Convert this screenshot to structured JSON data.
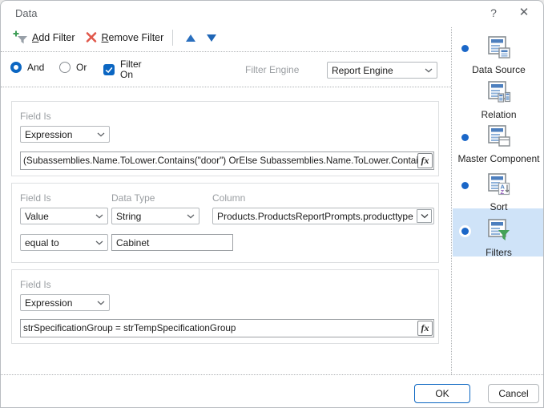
{
  "window": {
    "title": "Data",
    "help": "?",
    "close": "✕"
  },
  "toolbar": {
    "add_filter": {
      "accesskey": "A",
      "rest": "dd Filter"
    },
    "remove_filter": {
      "accesskey": "R",
      "rest": "emove Filter"
    }
  },
  "options": {
    "and_label": "And",
    "or_label": "Or",
    "filter_on_label": "Filter On",
    "filter_engine_label": "Filter Engine",
    "filter_engine_value": "Report Engine"
  },
  "filters": [
    {
      "field_is_label": "Field Is",
      "field_is_value": "Expression",
      "expression": "(Subassemblies.Name.ToLower.Contains(\"door\") OrElse Subassemblies.Name.ToLower.Contains(\"front",
      "fx_label": "fx"
    },
    {
      "field_is_label": "Field Is",
      "data_type_label": "Data Type",
      "column_label": "Column",
      "field_is_value": "Value",
      "data_type_value": "String",
      "column_value": "Products.ProductsReportPrompts.producttype",
      "operator_value": "equal to",
      "value_text": "Cabinet"
    },
    {
      "field_is_label": "Field Is",
      "field_is_value": "Expression",
      "expression": "strSpecificationGroup = strTempSpecificationGroup",
      "fx_label": "fx"
    }
  ],
  "sidebar": {
    "items": [
      {
        "label": "Data Source",
        "dot": true,
        "selected": false
      },
      {
        "label": "Relation",
        "dot": false,
        "selected": false
      },
      {
        "label": "Master Component",
        "dot": true,
        "selected": false
      },
      {
        "label": "Sort",
        "dot": true,
        "selected": false
      },
      {
        "label": "Filters",
        "dot": true,
        "selected": true
      }
    ]
  },
  "footer": {
    "ok_label": "OK",
    "cancel_label": "Cancel"
  },
  "colors": {
    "accent_blue": "#0b66c2",
    "selection_bg": "#cfe3f8",
    "dot_blue": "#1b67c8",
    "add_green": "#3f9e57",
    "remove_red": "#e0584b",
    "filter_green": "#43a257",
    "label_gray": "#999da1"
  }
}
